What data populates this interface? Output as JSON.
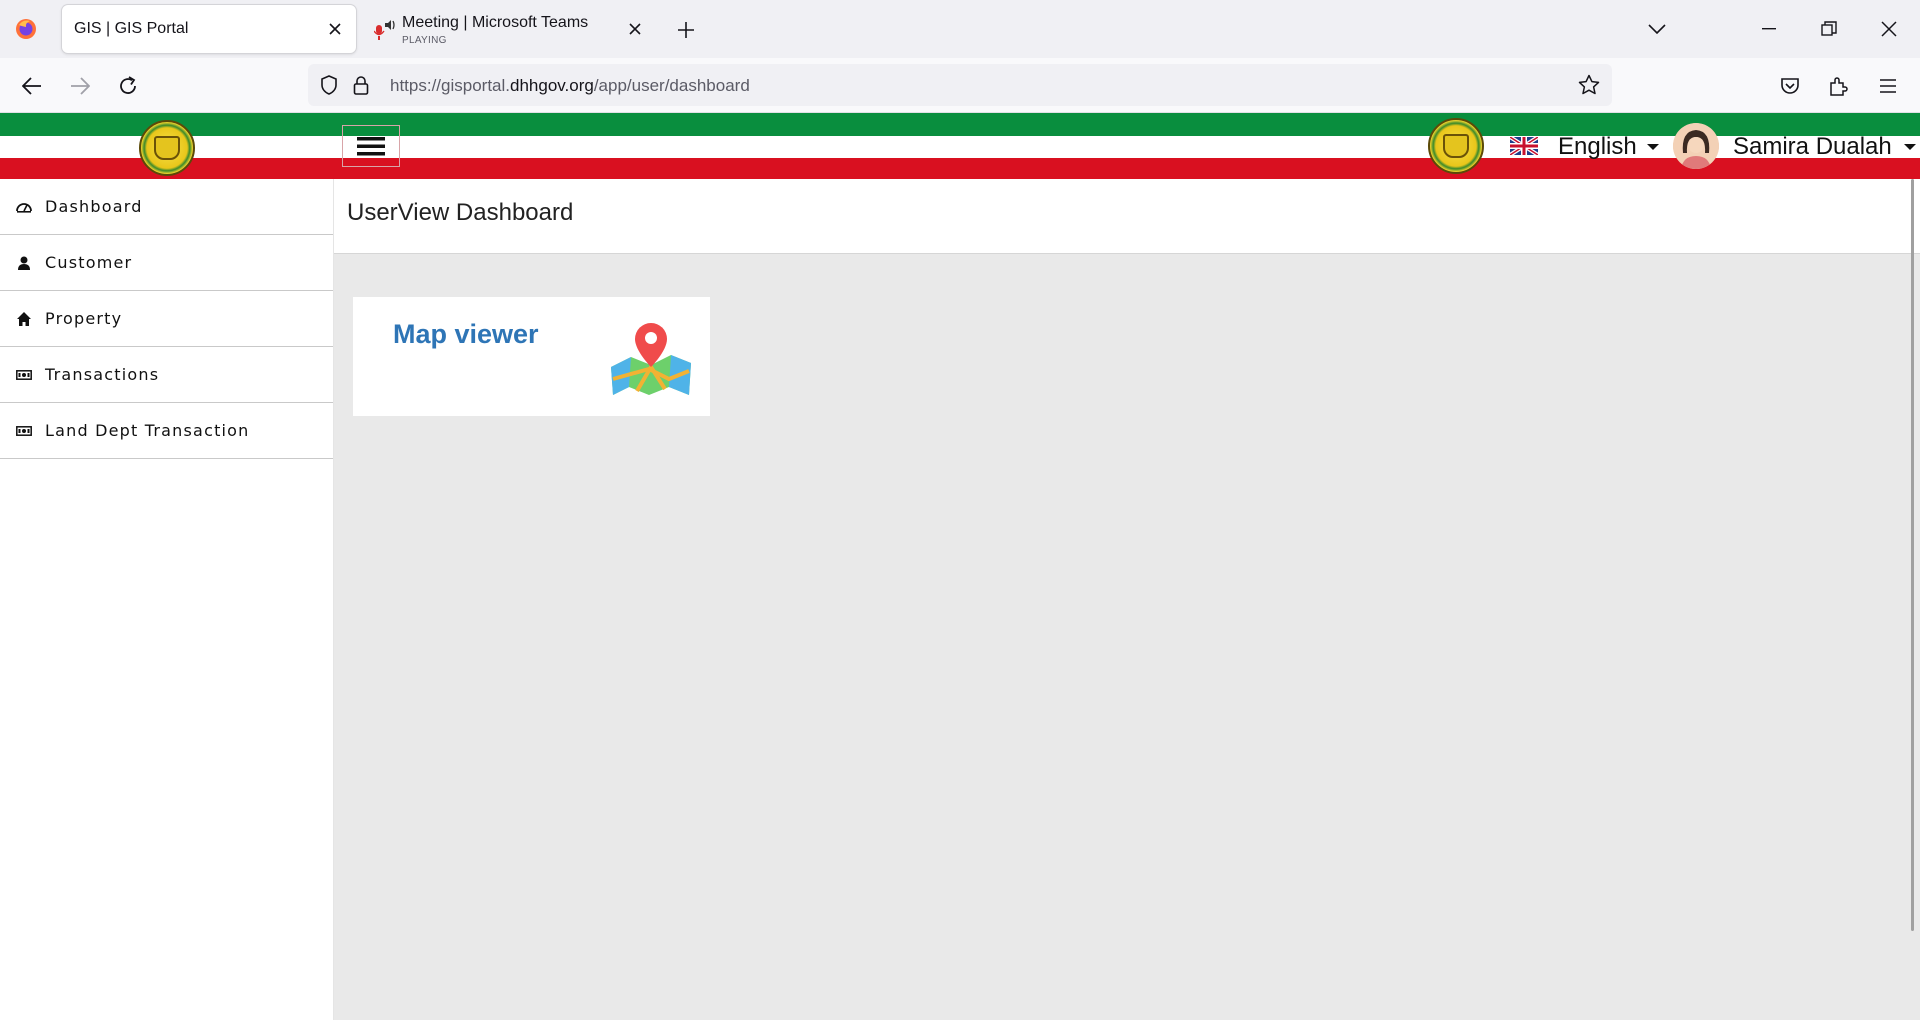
{
  "browser": {
    "tabs": [
      {
        "title": "GIS | GIS Portal",
        "active": true
      },
      {
        "title": "Meeting | Microsoft Teams",
        "subtitle": "PLAYING",
        "active": false
      }
    ],
    "url": {
      "prefix": "https://gisportal.",
      "domain": "dhhgov.org",
      "path": "/app/user/dashboard"
    }
  },
  "header": {
    "language": "English",
    "user_name": "Samira Dualah",
    "colors": {
      "green": "#098e3e",
      "white": "#ffffff",
      "red": "#d91020"
    }
  },
  "sidebar": {
    "items": [
      {
        "label": "Dashboard",
        "icon": "dashboard-icon"
      },
      {
        "label": "Customer",
        "icon": "user-icon"
      },
      {
        "label": "Property",
        "icon": "home-icon"
      },
      {
        "label": "Transactions",
        "icon": "money-icon"
      },
      {
        "label": "Land Dept Transaction",
        "icon": "money-icon"
      }
    ]
  },
  "main": {
    "title": "UserView Dashboard",
    "cards": [
      {
        "title": "Map viewer",
        "icon": "map-pin-icon",
        "title_color": "#2e75b6"
      }
    ]
  }
}
